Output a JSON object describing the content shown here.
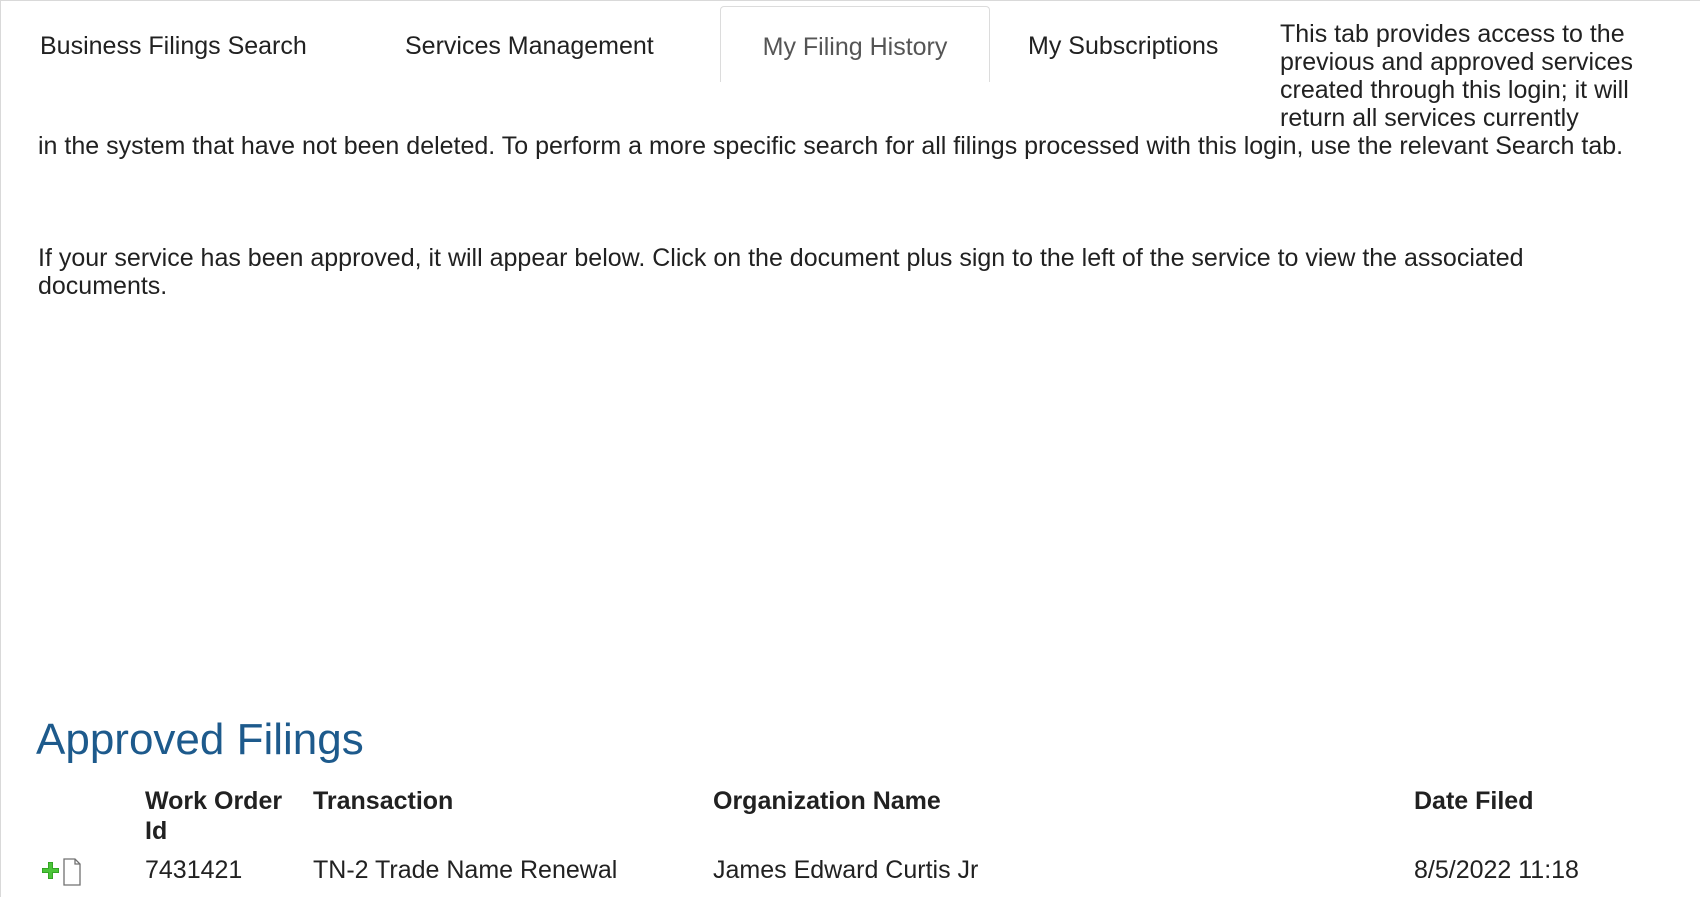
{
  "tabs": [
    {
      "label": "Business Filings Search",
      "active": false
    },
    {
      "label": "Services Management",
      "active": false
    },
    {
      "label": "My Filing History",
      "active": true
    },
    {
      "label": "My Subscriptions",
      "active": false
    }
  ],
  "description": {
    "part1": "This tab provides access to the previous and approved services created through this login; it will return all services currently",
    "part2": "in the system that have not been deleted. To perform a more specific search for all filings processed with this login, use the relevant Search tab.",
    "paragraph2": "If your service has been approved, it will appear below. Click on the document plus sign to the left of the service to view the associated documents."
  },
  "approved_filings": {
    "title": "Approved Filings",
    "columns": [
      "Work Order Id",
      "Transaction",
      "Organization Name",
      "Date Filed"
    ],
    "rows": [
      {
        "work_order_id": "7431421",
        "transaction": "TN-2 Trade Name Renewal",
        "organization_name": "James Edward Curtis Jr",
        "date_filed": "8/5/2022 11:18"
      }
    ]
  },
  "colors": {
    "title_blue": "#1d5a8c",
    "plus_green": "#2e9e1f"
  },
  "icons": {
    "row_expand": "document-plus-icon"
  }
}
